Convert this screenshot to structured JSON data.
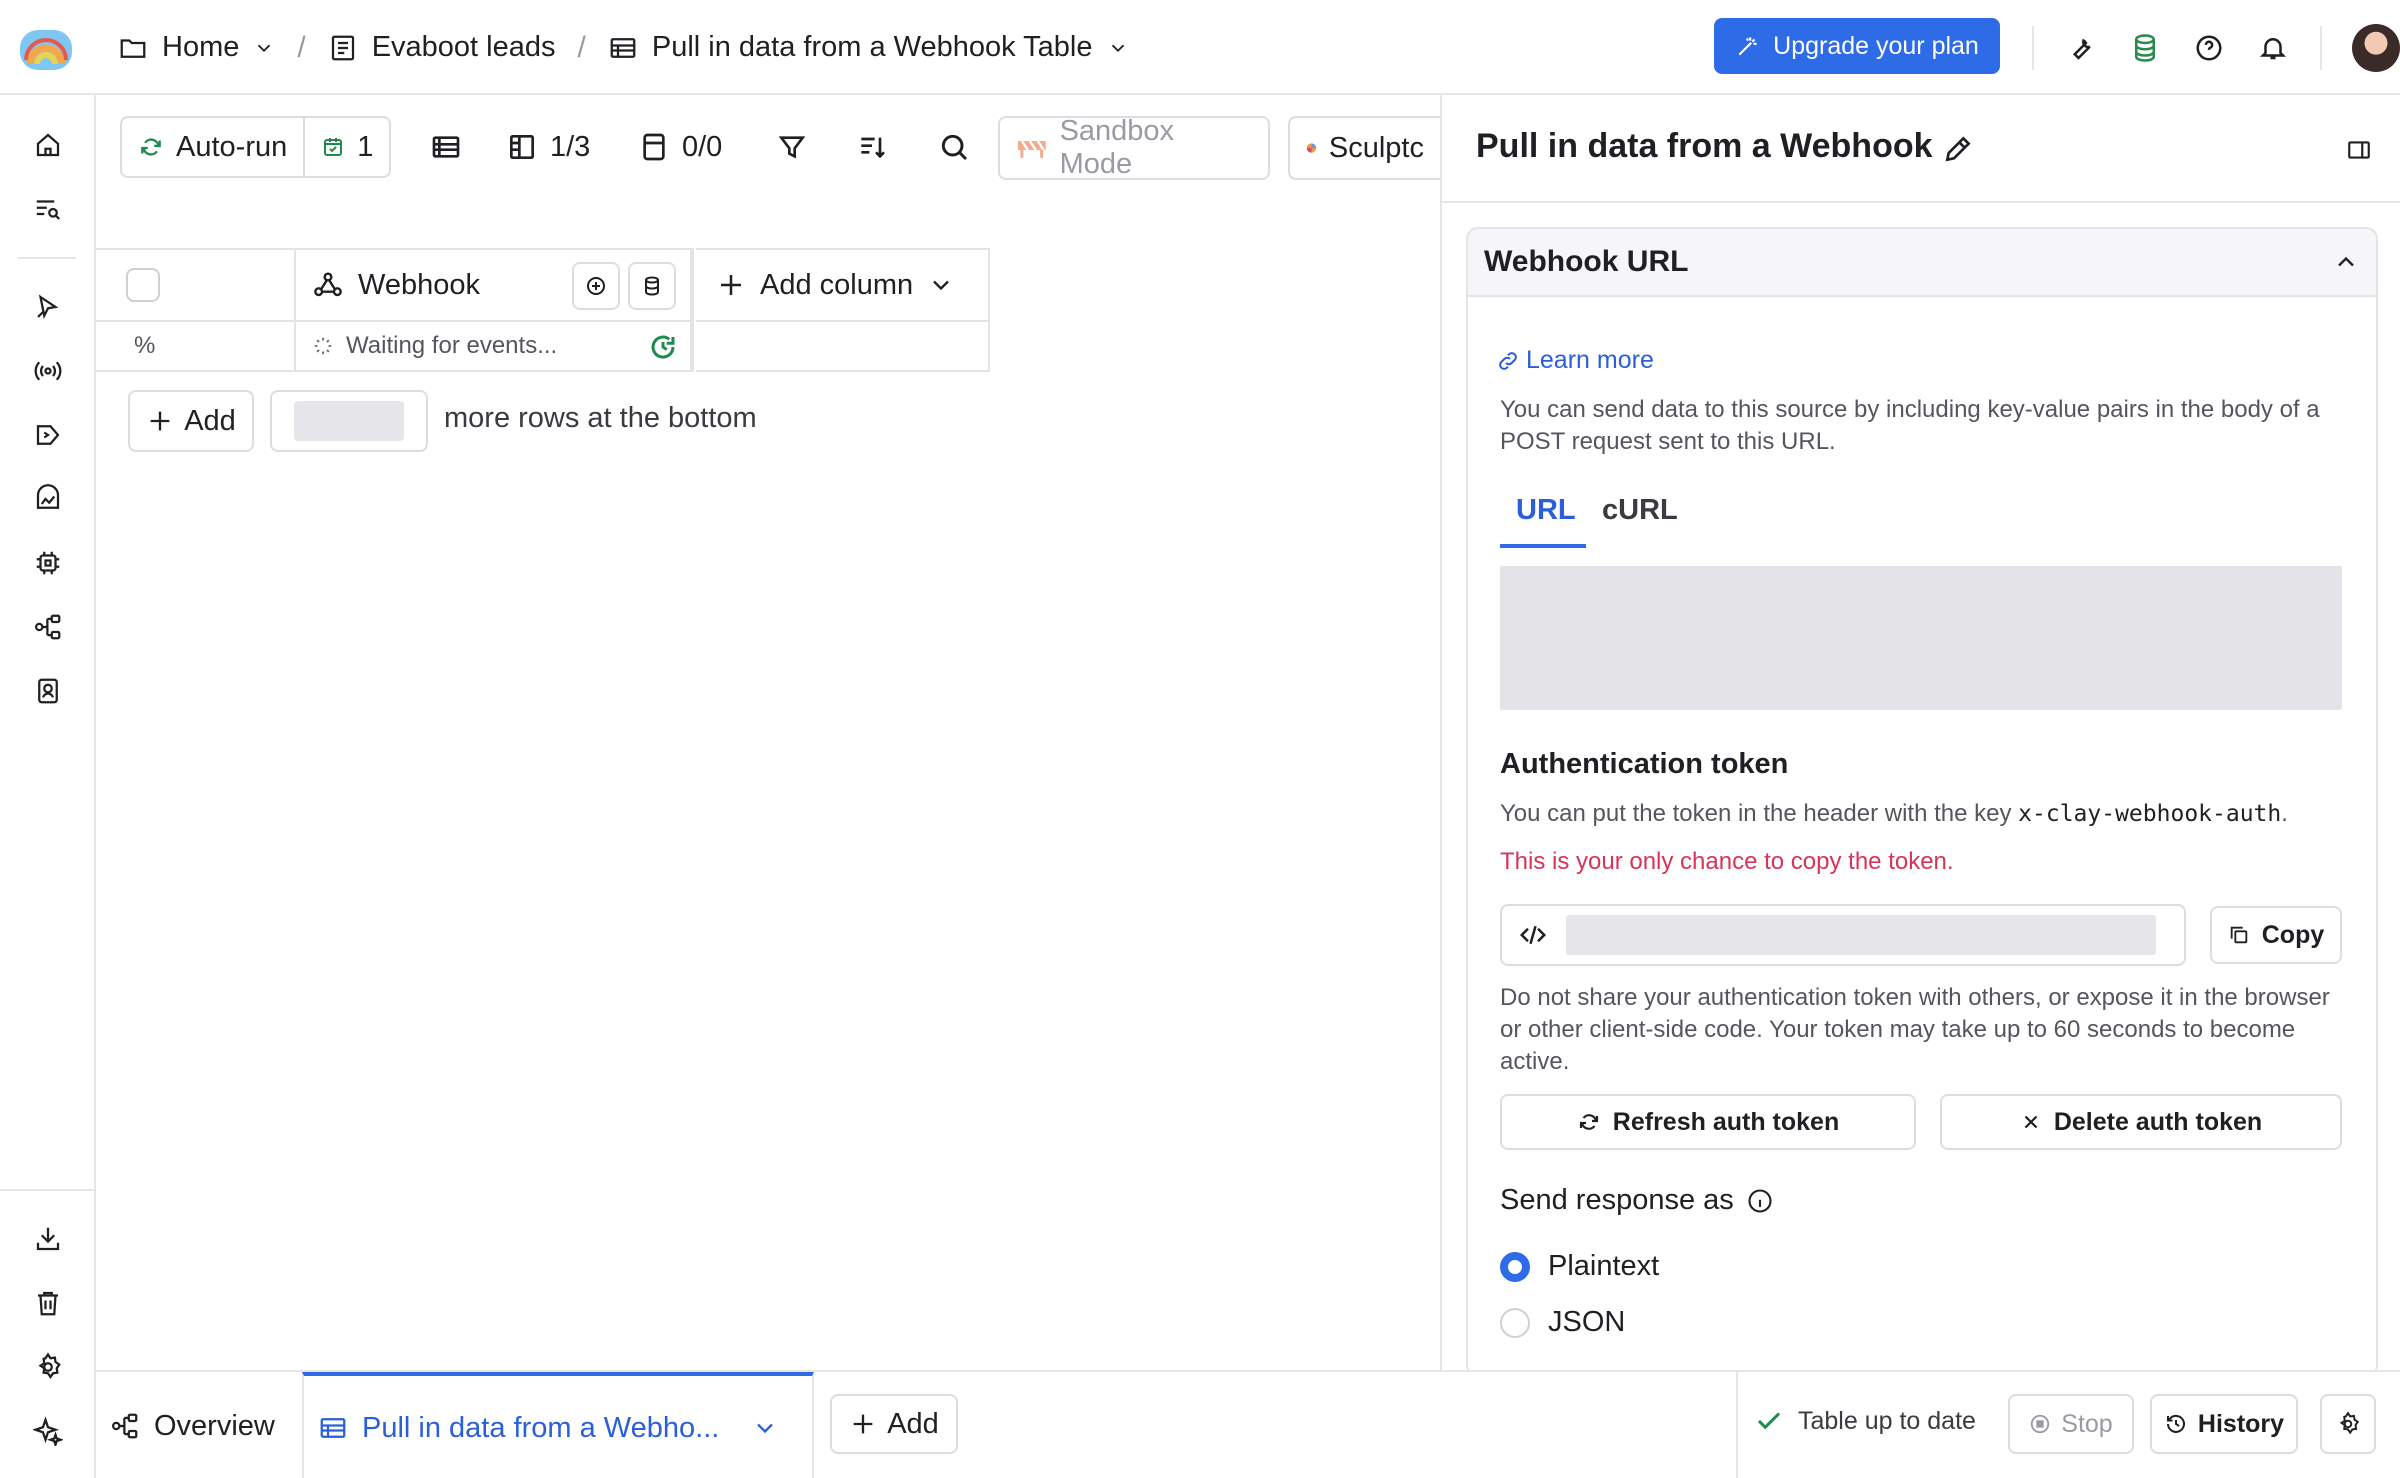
{
  "breadcrumb": {
    "home": "Home",
    "workspace": "Evaboot leads",
    "table": "Pull in data from a Webhook Table",
    "separator": "/"
  },
  "header": {
    "upgrade_label": "Upgrade your plan",
    "icons": [
      "wrench-icon",
      "credits-icon",
      "help-icon",
      "bell-icon"
    ]
  },
  "sidebar": {
    "icons": [
      "home-icon",
      "search-list-icon",
      "signals-icon",
      "broadcast-icon",
      "campaign-icon",
      "dashboard-icon",
      "integration-icon",
      "workflow-icon",
      "contacts-icon",
      "download-icon",
      "trash-icon",
      "settings-icon",
      "sparkle-icon"
    ]
  },
  "toolbar": {
    "autorun_label": "Auto-run",
    "autorun_count": "1",
    "columns_count": "1/3",
    "enrich_count": "0/0",
    "sandbox_label": "Sandbox Mode",
    "sculptor_label": "Sculptc"
  },
  "table": {
    "webhook_column": "Webhook",
    "add_column_label": "Add column",
    "row_index": "%",
    "row_status": "Waiting for events...",
    "add_rows_label": "Add",
    "more_rows_text": "more rows at the bottom"
  },
  "panel": {
    "title": "Pull in data from a Webhook",
    "section_title": "Webhook URL",
    "learn_more": "Learn more",
    "description": "You can send data to this source by including key-value pairs in the body of a POST request sent to this URL.",
    "tabs": [
      "URL",
      "cURL"
    ],
    "auth_title": "Authentication token",
    "auth_desc_prefix": "You can put the token in the header with the key ",
    "auth_key": "x-clay-webhook-auth",
    "auth_desc_suffix": ".",
    "auth_warning": "This is your only chance to copy the token.",
    "copy_label": "Copy",
    "auth_note": "Do not share your authentication token with others, or expose it in the browser or other client-side code. Your token may take up to 60 seconds to become active.",
    "refresh_label": "Refresh auth token",
    "delete_label": "Delete auth token",
    "response_title": "Send response as",
    "response_options": [
      "Plaintext",
      "JSON"
    ],
    "selected_option": "Plaintext"
  },
  "bottom": {
    "overview_label": "Overview",
    "active_tab": "Pull in data from a Webho...",
    "add_label": "Add",
    "status_label": "Table up to date",
    "stop_label": "Stop",
    "history_label": "History"
  },
  "colors": {
    "accent": "#2e6be6",
    "link": "#2a5fd8",
    "warning": "#d6345a",
    "success": "#1f8a4c"
  }
}
